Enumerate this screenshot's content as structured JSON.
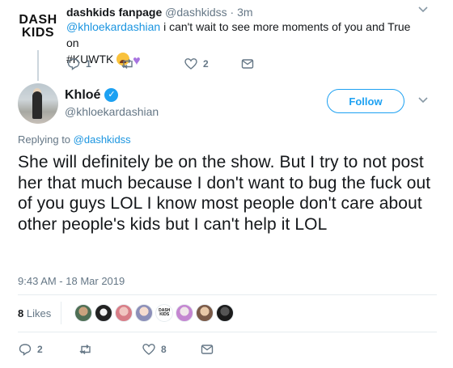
{
  "parent_tweet": {
    "name": "dashkids fanpage",
    "handle": "@dashkidss",
    "separator": "·",
    "time": "3m",
    "avatar_text_line1": "DASH",
    "avatar_text_line2": "KIDS",
    "mention": "@khloekardashian",
    "text": "i can't wait to see more moments of you and True on",
    "hashtag": "#KUWTK",
    "emoji": [
      "weary-face",
      "purple-heart"
    ],
    "actions": {
      "reply_count": "1",
      "retweet_count": "",
      "like_count": "2"
    }
  },
  "main_tweet": {
    "name": "Khloé",
    "handle": "@khloekardashian",
    "verified": true,
    "follow_label": "Follow",
    "replying_prefix": "Replying to",
    "replying_to": "@dashkidss",
    "text": "She will definitely be on the show. But I try to not post her that much because I don't want to bug the fuck out of you guys LOL I know most people don't care about other people's kids but I can't help it LOL",
    "timestamp": "9:43 AM - 18 Mar 2019",
    "likes_count": "8",
    "likes_label": "Likes",
    "liker_badge_line1": "DASH",
    "liker_badge_line2": "KIDS",
    "actions": {
      "reply_count": "2",
      "retweet_count": "",
      "like_count": "8"
    }
  },
  "colors": {
    "link": "#1b95e0",
    "brand": "#1da1f2",
    "muted": "#657786",
    "divider": "#e6ecf0"
  },
  "icons": [
    "chevron-down-icon",
    "reply-icon",
    "retweet-icon",
    "heart-icon",
    "message-icon",
    "verified-icon"
  ]
}
